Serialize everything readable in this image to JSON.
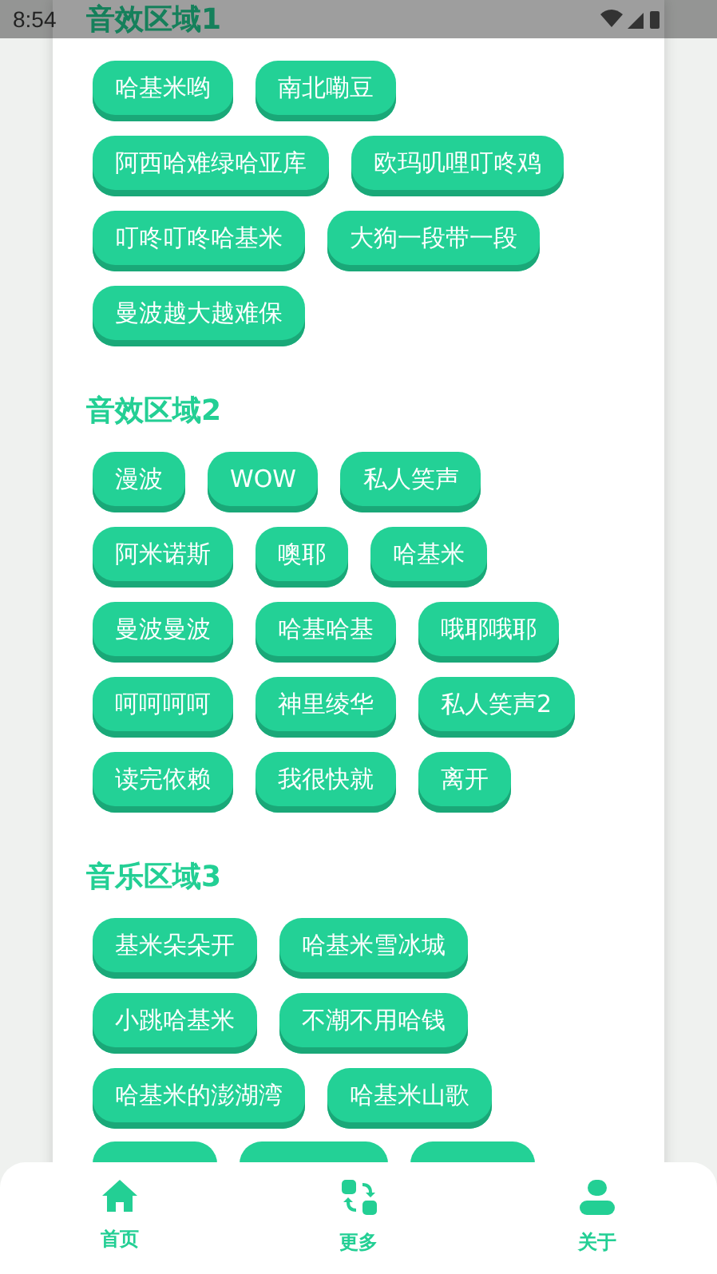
{
  "status_bar": {
    "time": "8:54"
  },
  "sections": [
    {
      "title": "音效区域1",
      "buttons": [
        {
          "label": "哈基米哟"
        },
        {
          "label": "南北嘞豆"
        },
        {
          "label": "阿西哈难绿哈亚库"
        },
        {
          "label": "欧玛叽哩叮咚鸡"
        },
        {
          "label": "叮咚叮咚哈基米"
        },
        {
          "label": "大狗一段带一段"
        },
        {
          "label": "曼波越大越难保"
        }
      ]
    },
    {
      "title": "音效区域2",
      "buttons": [
        {
          "label": "漫波"
        },
        {
          "label": "WOW"
        },
        {
          "label": "私人笑声"
        },
        {
          "label": "阿米诺斯"
        },
        {
          "label": "噢耶"
        },
        {
          "label": "哈基米"
        },
        {
          "label": "曼波曼波"
        },
        {
          "label": "哈基哈基"
        },
        {
          "label": "哦耶哦耶"
        },
        {
          "label": "呵呵呵呵"
        },
        {
          "label": "神里绫华"
        },
        {
          "label": "私人笑声2"
        },
        {
          "label": "读完依赖"
        },
        {
          "label": "我很快就"
        },
        {
          "label": "离开"
        }
      ]
    },
    {
      "title": "音乐区域3",
      "buttons": [
        {
          "label": "基米朵朵开"
        },
        {
          "label": "哈基米雪冰城"
        },
        {
          "label": "小跳哈基米"
        },
        {
          "label": "不潮不用哈钱"
        },
        {
          "label": "哈基米的澎湖湾"
        },
        {
          "label": "哈基米山歌"
        },
        {
          "cut_off": true
        },
        {
          "cut_off": true
        },
        {
          "cut_off": true
        }
      ]
    }
  ],
  "nav": [
    {
      "label": "首页",
      "kind": "home"
    },
    {
      "label": "更多",
      "kind": "more"
    },
    {
      "label": "关于",
      "kind": "user"
    }
  ]
}
